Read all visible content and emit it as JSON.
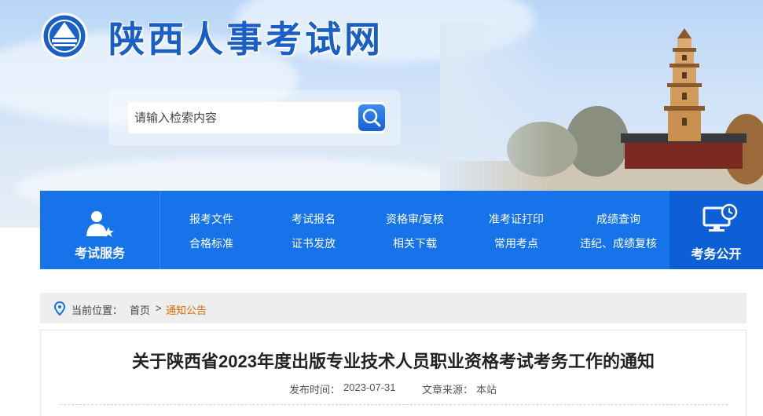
{
  "header": {
    "site_title": "陕西人事考试网",
    "search_placeholder": "请输入检索内容"
  },
  "nav": {
    "left_label": "考试服务",
    "right_label": "考务公开",
    "row1": [
      "报考文件",
      "考试报名",
      "资格审/复核",
      "准考证打印",
      "成绩查询"
    ],
    "row2": [
      "合格标准",
      "证书发放",
      "相关下载",
      "常用考点",
      "违纪、成绩复核"
    ]
  },
  "breadcrumb": {
    "prefix": "当前位置：",
    "home": "首页",
    "separator": ">",
    "current": "通知公告"
  },
  "article": {
    "title": "关于陕西省2023年度出版专业技术人员职业资格考试考务工作的通知",
    "publish_label": "发布时间：",
    "publish_date": "2023-07-31",
    "source_label": "文章来源：",
    "source": "本站"
  },
  "colors": {
    "brand_blue": "#1673ea",
    "accent_orange": "#e06a00"
  }
}
